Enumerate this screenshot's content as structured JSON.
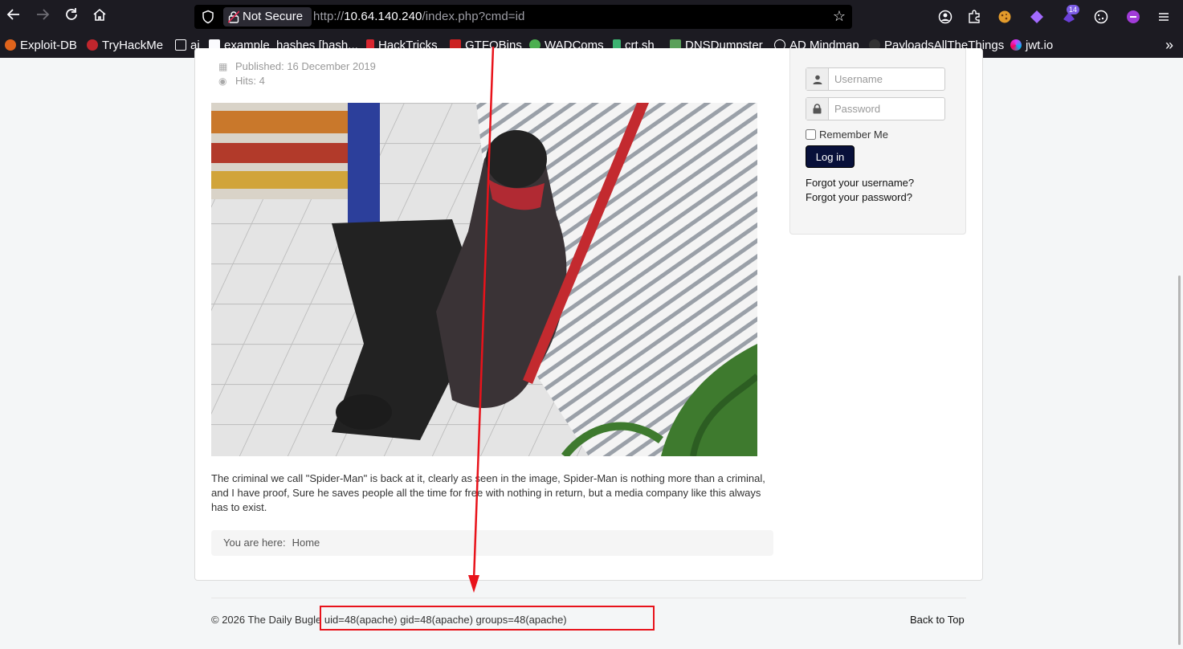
{
  "browser": {
    "url_prefix": "http://",
    "url_host": "10.64.140.240",
    "url_path": "/index.php?cmd=id",
    "security_label": "Not Secure",
    "extension_badge": "14"
  },
  "bookmarks": [
    {
      "label": "Exploit-DB",
      "color": "#e0641c"
    },
    {
      "label": "TryHackMe",
      "color": "#c0262d"
    },
    {
      "label": "ai",
      "color": "#fbfbfe"
    },
    {
      "label": "example_hashes [hash...",
      "color": "#fbfbfe"
    },
    {
      "label": "HackTricks",
      "color": "#d8262f"
    },
    {
      "label": "GTFOBins",
      "color": "#cc2222"
    },
    {
      "label": "WADComs",
      "color": "#4caf50"
    },
    {
      "label": "crt.sh",
      "color": "#3cb371"
    },
    {
      "label": "DNSDumpster",
      "color": "#5aa05a"
    },
    {
      "label": "AD Mindmap",
      "color": "#fbfbfe"
    },
    {
      "label": "PayloadsAllTheThings",
      "color": "#333333"
    },
    {
      "label": "jwt.io",
      "color": "#d63aff"
    }
  ],
  "article": {
    "published": "Published: 16 December 2019",
    "hits": "Hits: 4",
    "body": "The criminal we call \"Spider-Man\" is back at it, clearly as seen in the image, Spider-Man is nothing more than a criminal, and I have proof, Sure he saves people all the time for free with nothing in return, but a media company like this always has to exist."
  },
  "breadcrumb": {
    "prefix": "You are here:",
    "home": "Home"
  },
  "login": {
    "username_placeholder": "Username",
    "password_placeholder": "Password",
    "remember_label": "Remember Me",
    "button_label": "Log in",
    "forgot_username": "Forgot your username?",
    "forgot_password": "Forgot your password?"
  },
  "footer": {
    "copyright": "© 2026 The Daily Bugle",
    "command_output": "uid=48(apache) gid=48(apache) groups=48(apache)",
    "back_to_top": "Back to Top"
  },
  "annotation": {
    "color": "#e8131b"
  }
}
